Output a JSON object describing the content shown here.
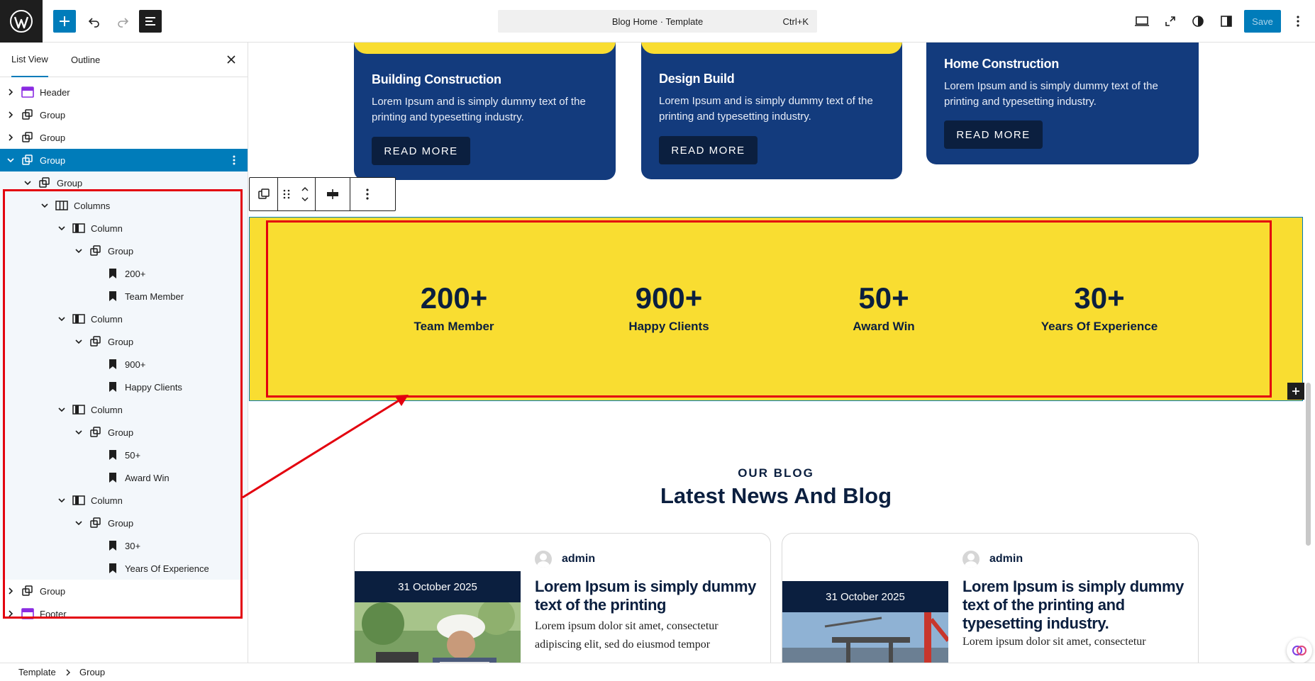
{
  "topbar": {
    "document_title": "Blog Home · Template",
    "shortcut": "Ctrl+K",
    "save_label": "Save"
  },
  "sidebar": {
    "tabs": [
      "List View",
      "Outline"
    ],
    "tree": [
      {
        "label": "Header",
        "icon": "template-part-icon"
      },
      {
        "label": "Group",
        "icon": "group-icon"
      },
      {
        "label": "Group",
        "icon": "group-icon"
      },
      {
        "label": "Group",
        "icon": "group-icon",
        "selected": true
      },
      {
        "label": "Group",
        "icon": "group-icon"
      },
      {
        "label": "Columns",
        "icon": "columns-icon"
      },
      {
        "label": "Column",
        "icon": "column-icon"
      },
      {
        "label": "Group",
        "icon": "group-icon"
      },
      {
        "label": "200+",
        "icon": "heading-bookmark-icon"
      },
      {
        "label": "Team Member",
        "icon": "heading-bookmark-icon"
      },
      {
        "label": "Column",
        "icon": "column-icon"
      },
      {
        "label": "Group",
        "icon": "group-icon"
      },
      {
        "label": "900+",
        "icon": "heading-bookmark-icon"
      },
      {
        "label": "Happy Clients",
        "icon": "heading-bookmark-icon"
      },
      {
        "label": "Column",
        "icon": "column-icon"
      },
      {
        "label": "Group",
        "icon": "group-icon"
      },
      {
        "label": "50+",
        "icon": "heading-bookmark-icon"
      },
      {
        "label": "Award Win",
        "icon": "heading-bookmark-icon"
      },
      {
        "label": "Column",
        "icon": "column-icon"
      },
      {
        "label": "Group",
        "icon": "group-icon"
      },
      {
        "label": "30+",
        "icon": "heading-bookmark-icon"
      },
      {
        "label": "Years Of Experience",
        "icon": "heading-bookmark-icon"
      },
      {
        "label": "Group",
        "icon": "group-icon"
      },
      {
        "label": "Footer",
        "icon": "template-part-icon"
      }
    ]
  },
  "services": [
    {
      "title": "Building Construction",
      "desc": "Lorem Ipsum and is simply dummy text of the printing and typesetting industry.",
      "button": "READ MORE"
    },
    {
      "title": "Design Build",
      "desc": "Lorem Ipsum and is simply dummy text of the printing and typesetting industry.",
      "button": "READ MORE"
    },
    {
      "title": "Home Construction",
      "desc": "Lorem Ipsum and is simply dummy text of the printing and typesetting industry.",
      "button": "READ MORE"
    }
  ],
  "stats": [
    {
      "number": "200+",
      "label": "Team Member"
    },
    {
      "number": "900+",
      "label": "Happy Clients"
    },
    {
      "number": "50+",
      "label": "Award Win"
    },
    {
      "number": "30+",
      "label": "Years Of Experience"
    }
  ],
  "blog": {
    "kicker": "OUR BLOG",
    "title": "Latest News And Blog",
    "posts": [
      {
        "author": "admin",
        "date": "31 October 2025",
        "title": "Lorem Ipsum is simply dummy text of the printing",
        "excerpt": "Lorem ipsum dolor sit amet, consectetur adipiscing elit, sed do eiusmod tempor"
      },
      {
        "author": "admin",
        "date": "31 October 2025",
        "title": "Lorem Ipsum is simply dummy text of the printing and typesetting industry.",
        "excerpt": "Lorem ipsum dolor sit amet, consectetur"
      }
    ]
  },
  "breadcrumbs": [
    "Template",
    "Group"
  ],
  "colors": {
    "accent": "#007cba",
    "navy": "#133b7d",
    "dark_navy": "#0b1f3f",
    "yellow": "#f9dd31",
    "highlight_red": "#e3000e"
  }
}
